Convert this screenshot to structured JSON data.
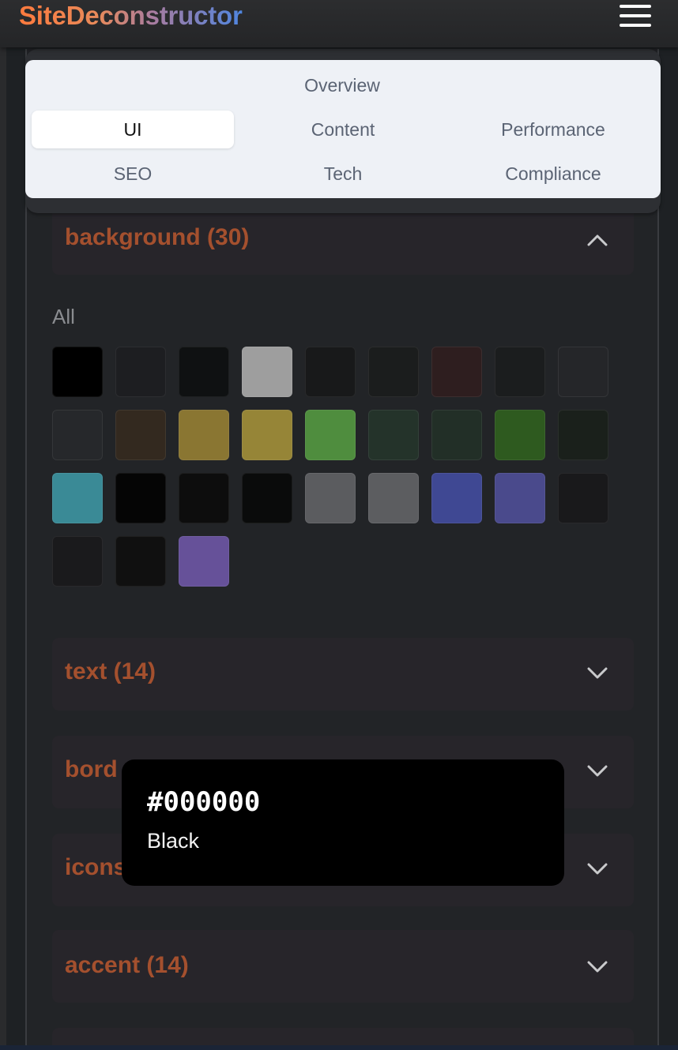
{
  "header": {
    "logo": "SiteDeconstructor",
    "menu_icon": "hamburger-menu-icon"
  },
  "tabs": [
    {
      "label": "Overview",
      "active": false
    },
    {
      "label": "UI",
      "active": true
    },
    {
      "label": "Content",
      "active": false
    },
    {
      "label": "Performance",
      "active": false
    },
    {
      "label": "SEO",
      "active": false
    },
    {
      "label": "Tech",
      "active": false
    },
    {
      "label": "Compliance",
      "active": false
    }
  ],
  "sections": [
    {
      "title": "background (30)",
      "expanded": true
    },
    {
      "title": "text (14)",
      "expanded": false
    },
    {
      "title": "bord",
      "expanded": false
    },
    {
      "title": "icons",
      "expanded": false
    },
    {
      "title": "accent (14)",
      "expanded": false
    }
  ],
  "background_filter": "All",
  "swatches": [
    "#000000",
    "#1d1e21",
    "#0f1112",
    "#9e9e9e",
    "#18191a",
    "#1b1d1d",
    "#2e1e1f",
    "#1b1d1e",
    "#252629",
    "#26282b",
    "#33291f",
    "#8a7632",
    "#968537",
    "#4f8d3e",
    "#24332a",
    "#222f27",
    "#2e5a1f",
    "#1a201b",
    "#3a8a96",
    "#050505",
    "#0d0d0d",
    "#0a0b0b",
    "#5b5c5f",
    "#5c5d60",
    "#3f4893",
    "#4a4a8c",
    "#19191b",
    "#1a1a1c",
    "#101010",
    "#665199"
  ],
  "tooltip": {
    "hex": "#000000",
    "name": "Black"
  }
}
